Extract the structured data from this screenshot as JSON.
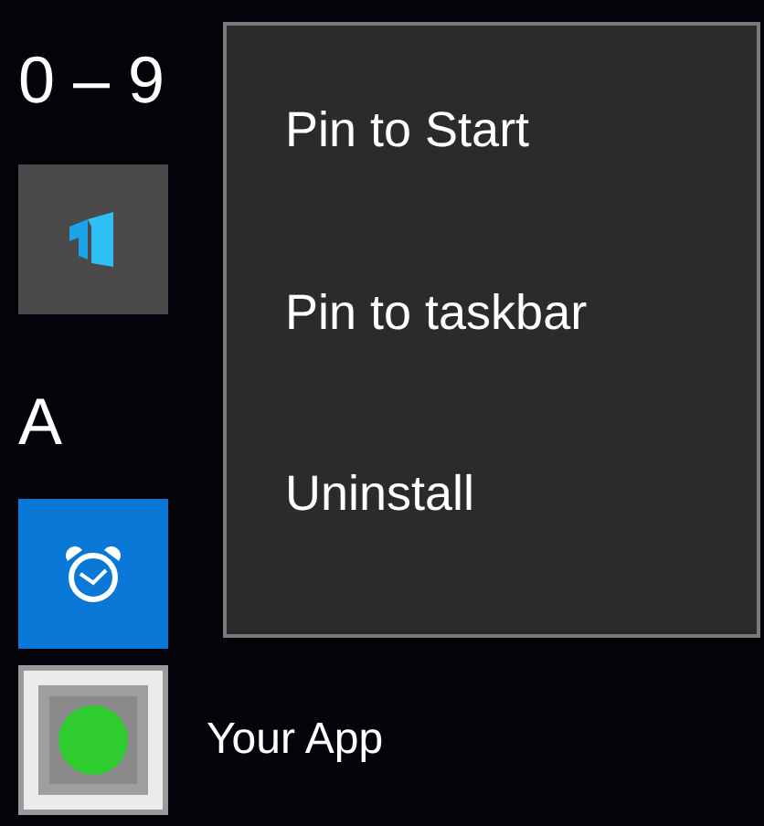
{
  "groups": [
    {
      "header": "0 – 9",
      "apps": [
        {
          "kind": "building"
        }
      ]
    },
    {
      "header": "A",
      "apps": [
        {
          "kind": "alarm"
        },
        {
          "name": "Your App",
          "kind": "custom"
        }
      ]
    }
  ],
  "context_menu": {
    "items": [
      {
        "label": "Pin to Start"
      },
      {
        "label": "Pin to taskbar"
      },
      {
        "label": "Uninstall"
      }
    ]
  }
}
